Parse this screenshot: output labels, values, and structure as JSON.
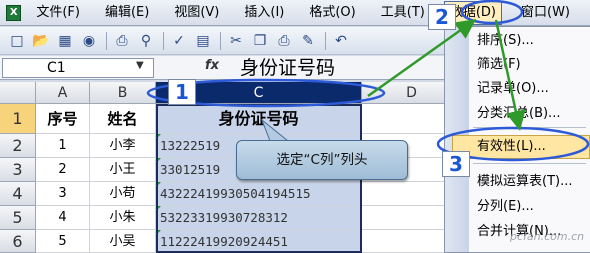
{
  "menubar": {
    "items": [
      "文件(F)",
      "编辑(E)",
      "视图(V)",
      "插入(I)",
      "格式(O)",
      "工具(T)",
      "数据(D)",
      "窗口(W)"
    ]
  },
  "toolbar": {
    "icons": [
      "new-icon",
      "open-icon",
      "save-icon",
      "permission-icon",
      "print-icon",
      "print-preview-icon",
      "spelling-icon",
      "research-icon",
      "cut-icon",
      "copy-icon",
      "paste-icon",
      "format-painter-icon",
      "undo-icon"
    ]
  },
  "formula_bar": {
    "name_box": "C1",
    "fx": "fx",
    "value": "身份证号码"
  },
  "grid": {
    "columns": [
      "A",
      "B",
      "C",
      "D"
    ],
    "rows": [
      "1",
      "2",
      "3",
      "4",
      "5",
      "6"
    ],
    "headers": [
      "序号",
      "姓名",
      "身份证号码"
    ],
    "data": [
      [
        "1",
        "小李",
        "13222519"
      ],
      [
        "2",
        "小王",
        "33012519"
      ],
      [
        "3",
        "小苟",
        "43222419930504194515"
      ],
      [
        "4",
        "小朱",
        "53223319930728312"
      ],
      [
        "5",
        "小吴",
        "11222419920924451"
      ]
    ]
  },
  "callout": {
    "text": "选定“C列”列头"
  },
  "steps": [
    "1",
    "2",
    "3"
  ],
  "data_menu": {
    "items": [
      "排序(S)...",
      "筛选(F)",
      "记录单(O)...",
      "分类汇总(B)...",
      "有效性(L)...",
      "模拟运算表(T)...",
      "分列(E)...",
      "合并计算(N)..."
    ]
  },
  "watermark": "pcfan.com.cn",
  "colors": {
    "selected_col_header": "#0a2a6b",
    "selected_col_fill": "#c7d4ea",
    "highlight_ellipse": "#2c5ad8",
    "arrow": "#2f9a2a",
    "active_menu_item": "#ffe6a3"
  }
}
